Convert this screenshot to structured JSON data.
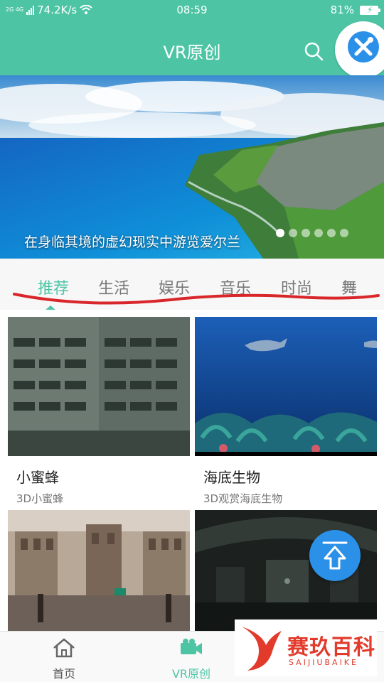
{
  "status_bar": {
    "network": "2G 4G",
    "speed": "74.2K/s",
    "time": "08:59",
    "battery": "81%"
  },
  "header": {
    "title": "VR原创",
    "accent_color": "#4dc5a5"
  },
  "banner": {
    "caption": "在身临其境的虚幻现实中游览爱尔兰",
    "dots_count": 6,
    "active_dot": 0
  },
  "tabs": [
    {
      "label": "推荐",
      "active": true
    },
    {
      "label": "生活",
      "active": false
    },
    {
      "label": "娱乐",
      "active": false
    },
    {
      "label": "音乐",
      "active": false
    },
    {
      "label": "时尚",
      "active": false
    },
    {
      "label": "舞",
      "active": false
    }
  ],
  "videos": [
    {
      "title": "小蜜蜂",
      "subtitle": "3D小蜜蜂",
      "thumb_icon": "cockpit-image"
    },
    {
      "title": "海底生物",
      "subtitle": "3D观赏海底生物",
      "thumb_icon": "underwater-image"
    },
    {
      "title": "",
      "subtitle": "",
      "thumb_icon": "street-image"
    },
    {
      "title": "",
      "subtitle": "",
      "thumb_icon": "dark-interior-image"
    }
  ],
  "bottom_nav": [
    {
      "label": "首页",
      "icon": "home-icon",
      "active": false
    },
    {
      "label": "VR原创",
      "icon": "vr-camera-icon",
      "active": true
    }
  ],
  "watermark": {
    "text": "赛玖百科",
    "sub": "SAIJIUBAIKE"
  }
}
